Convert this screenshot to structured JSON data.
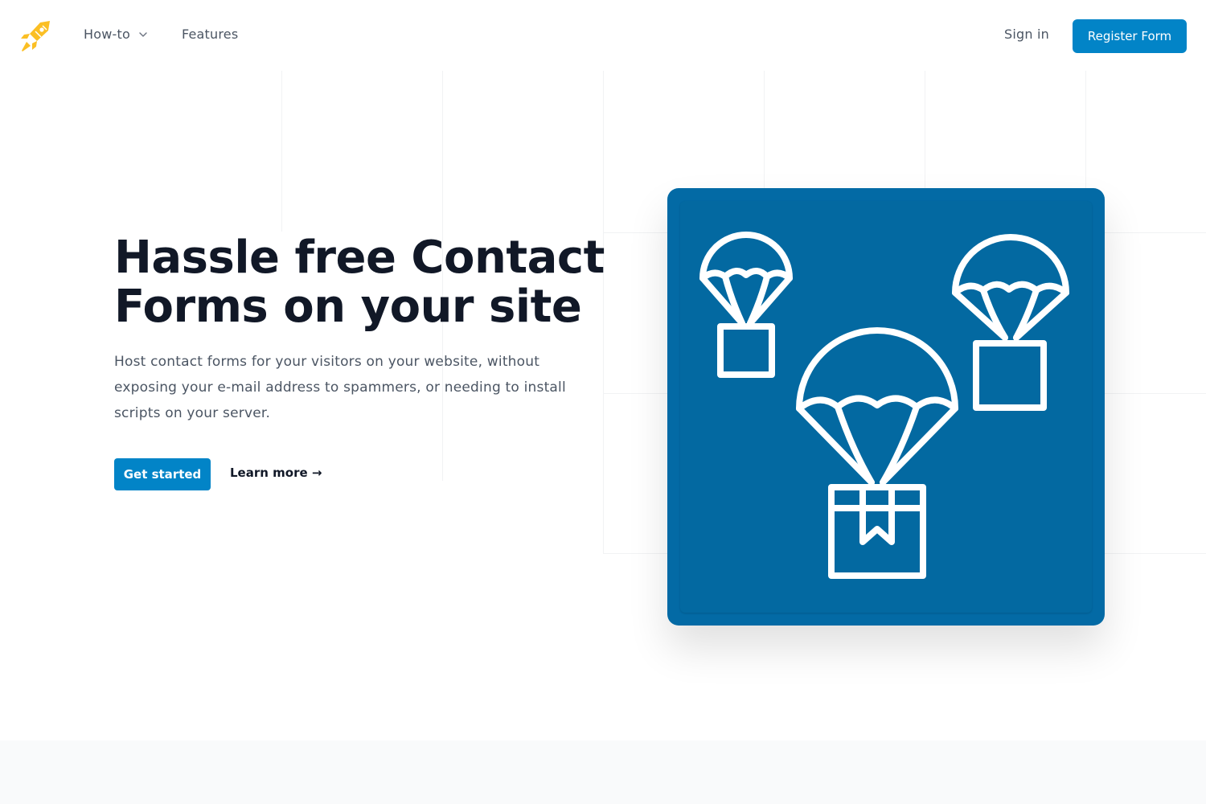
{
  "nav": {
    "howto_label": "How-to",
    "features_label": "Features",
    "signin_label": "Sign in",
    "register_label": "Register Form"
  },
  "hero": {
    "headline_line1": "Hassle free Contact",
    "headline_line2": "Forms on your site",
    "description": "Host contact forms for your visitors on your website, without exposing your e-mail address to spammers, or needing to install scripts on your server.",
    "cta_primary": "Get started",
    "cta_secondary": "Learn more →"
  },
  "colors": {
    "accent": "#0284c7",
    "illustration_bg": "#0369a1",
    "logo": "#fbbf24"
  },
  "icons": {
    "logo": "rocket-icon",
    "howto_dropdown": "chevron-down-icon",
    "illustration": "parachute-packages-icon"
  }
}
